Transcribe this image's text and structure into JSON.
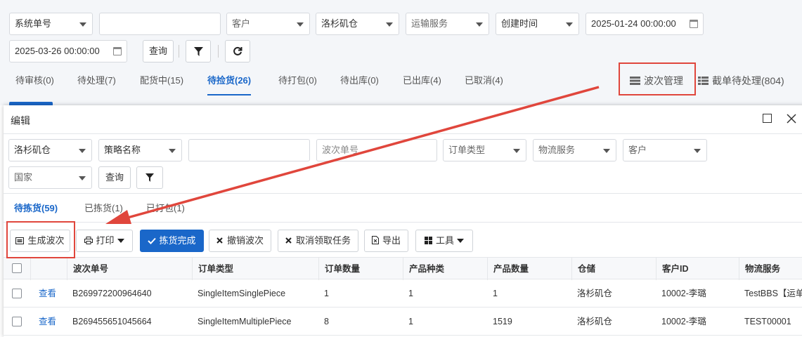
{
  "filters": {
    "order_field": "系统单号",
    "order_value": "",
    "customer_placeholder": "客户",
    "warehouse": "洛杉矶仓",
    "shipping_placeholder": "运输服务",
    "time_type": "创建时间",
    "start_date": "2025-01-24 00:00:00",
    "end_date": "2025-03-26 00:00:00",
    "query": "查询"
  },
  "tabs": [
    {
      "label": "待审核(0)"
    },
    {
      "label": "待处理(7)"
    },
    {
      "label": "配货中(15)"
    },
    {
      "label": "待捡货(26)"
    },
    {
      "label": "待打包(0)"
    },
    {
      "label": "待出库(0)"
    },
    {
      "label": "已出库(4)"
    },
    {
      "label": "已取消(4)"
    }
  ],
  "right_actions": {
    "wave": "波次管理",
    "intercept": "截单待处理(804)"
  },
  "modal": {
    "title": "编辑",
    "filters": {
      "warehouse": "洛杉矶仓",
      "strategy_placeholder": "策略名称",
      "free_input": "",
      "wave_no_placeholder": "波次单号",
      "order_type_placeholder": "订单类型",
      "logistics_placeholder": "物流服务",
      "customer_placeholder": "客户",
      "country_placeholder": "国家",
      "query": "查询"
    },
    "tabs": [
      {
        "label": "待拣货(59)"
      },
      {
        "label": "已拣货(1)"
      },
      {
        "label": "已打包(1)"
      }
    ],
    "actions": {
      "generate": "生成波次",
      "print": "打印",
      "pick_done": "拣货完成",
      "cancel_wave": "撤销波次",
      "cancel_task": "取消领取任务",
      "export": "导出",
      "tools": "工具"
    },
    "columns": [
      "波次单号",
      "订单类型",
      "订单数量",
      "产品种类",
      "产品数量",
      "仓储",
      "客户ID",
      "物流服务"
    ],
    "rows": [
      {
        "action": "查看",
        "wave_no": "B269972200964640",
        "order_type": "SingleItemSinglePiece",
        "order_count": "1",
        "kinds": "1",
        "qty": "1",
        "warehouse": "洛杉矶仓",
        "customer": "10002-李璐",
        "logistics": "TestBBS【运单"
      },
      {
        "action": "查看",
        "wave_no": "B269455651045664",
        "order_type": "SingleItemMultiplePiece",
        "order_count": "8",
        "kinds": "1",
        "qty": "1519",
        "warehouse": "洛杉矶仓",
        "customer": "10002-李璐",
        "logistics": "TEST00001"
      }
    ]
  },
  "colors": {
    "primary": "#1a67c9",
    "annotation": "#e0463c"
  }
}
